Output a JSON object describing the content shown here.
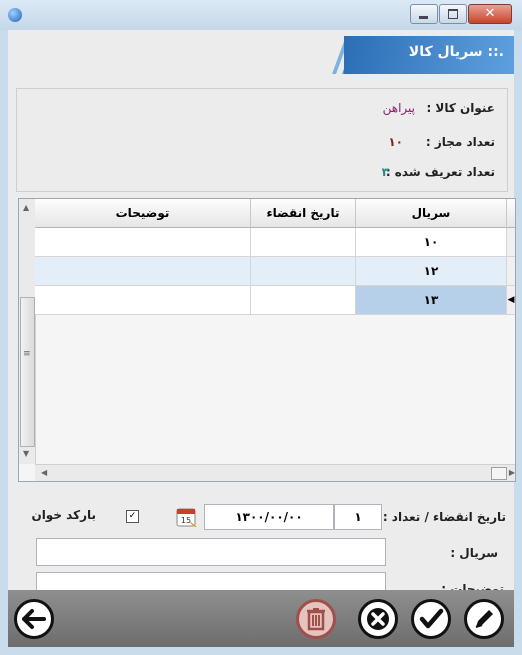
{
  "header": {
    "title": ".:: سریال کالا"
  },
  "info": {
    "product_label": "عنوان کالا :",
    "product_value": "پیراهن",
    "allowed_label": "تعداد مجاز :",
    "allowed_value": "۱۰",
    "defined_label": "تعداد تعریف شده :",
    "defined_value": "۳"
  },
  "colors": {
    "product": "#8a1d6f",
    "allowed": "#8a1d1d",
    "defined": "#2b8a7f",
    "banner": "#3a7ec8",
    "selected_row": "#b7d0ea"
  },
  "grid": {
    "columns": [
      "سریال",
      "تاریخ انقضاء",
      "توضیحات"
    ],
    "rows": [
      {
        "serial": "۱۰",
        "expiry": "",
        "notes": ""
      },
      {
        "serial": "۱۲",
        "expiry": "",
        "notes": ""
      },
      {
        "serial": "۱۳",
        "expiry": "",
        "notes": ""
      }
    ],
    "selected_row": 2
  },
  "form": {
    "expiry_count_label": "تاریخ انقضاء / تعداد :",
    "count_value": "۱",
    "date_value": "۱۳۰۰/۰۰/۰۰",
    "barcode_label": "بارکد خوان",
    "barcode_checked": true,
    "serial_label": "سریال :",
    "serial_value": "",
    "notes_label": "توضیحات :",
    "notes_value": "",
    "calendar_day": "15"
  },
  "toolbar": {
    "icons": [
      "arrow-left-icon",
      "trash-icon",
      "cancel-icon",
      "check-icon",
      "edit-icon"
    ]
  }
}
